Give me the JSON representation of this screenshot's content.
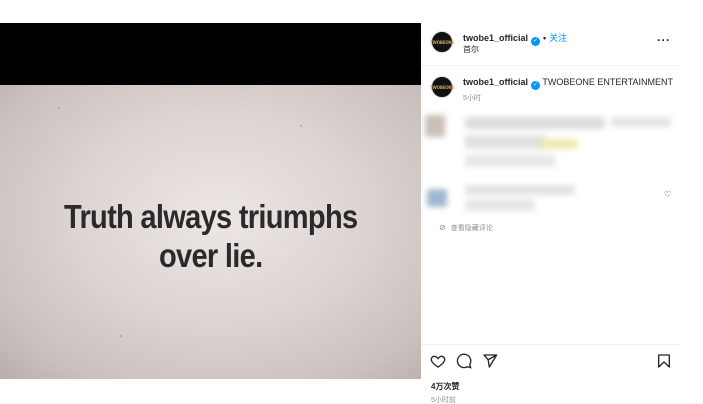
{
  "media": {
    "headline_line1": "Truth always triumphs",
    "headline_line2": "over lie."
  },
  "post": {
    "username": "twobe1_official",
    "follow_label": "关注",
    "separator": "•",
    "location": "首尔",
    "more_label": "•••"
  },
  "caption": {
    "username": "twobe1_official",
    "text": "TWOBEONE ENTERTAINMENT",
    "time": "5小时"
  },
  "comments": {
    "hidden_label": "查看隐藏评论"
  },
  "footer": {
    "likes": "4万次赞",
    "time": "5小时前"
  },
  "icons": {
    "verified": "verified-badge-icon",
    "like": "heart-icon",
    "comment": "comment-icon",
    "share": "paper-plane-icon",
    "save": "bookmark-icon",
    "hidden": "eye-slash-icon"
  },
  "colors": {
    "accent": "#0095f6",
    "muted": "#8e8e8e",
    "text": "#262626"
  }
}
